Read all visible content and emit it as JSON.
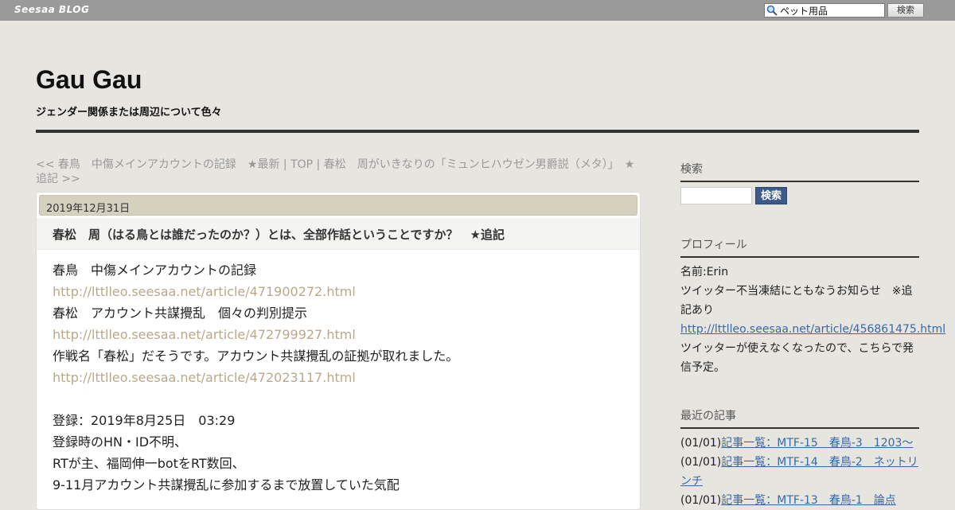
{
  "topbar": {
    "logo": "Seesaa BLOG",
    "search_value": "ペット用品",
    "search_button": "検索"
  },
  "header": {
    "title": "Gau Gau",
    "description": "ジェンダー関係または周辺について色々"
  },
  "article_nav": {
    "prev": "<< 春鳥　中傷メインアカウントの記録　★最新",
    "sep1": " | ",
    "top": "TOP",
    "sep2": " | ",
    "next": "春松　周がいきなりの「ミュンヒハウゼン男爵説（メタ）」　★追記 >>"
  },
  "entry": {
    "date": "2019年12月31日",
    "title": "春松　周（はる鳥とは誰だったのか？）とは、全部作話ということですか？　★追記",
    "lines": [
      {
        "text": "春鳥　中傷メインアカウントの記録",
        "link": false
      },
      {
        "text": "http://lttlleo.seesaa.net/article/471900272.html",
        "link": true
      },
      {
        "text": "春松　アカウント共謀攪乱　個々の判別提示",
        "link": false
      },
      {
        "text": "http://lttlleo.seesaa.net/article/472799927.html",
        "link": true
      },
      {
        "text": "作戦名「春松」だそうです。アカウント共謀攪乱の証拠が取れました。",
        "link": false
      },
      {
        "text": "http://lttlleo.seesaa.net/article/472023117.html",
        "link": true
      },
      {
        "text": "",
        "link": false
      },
      {
        "text": "登録：2019年8月25日　03:29",
        "link": false
      },
      {
        "text": "登録時のHN・ID不明、",
        "link": false
      },
      {
        "text": "RTが主、福岡伸一botをRT数回、",
        "link": false
      },
      {
        "text": "9-11月アカウント共謀攪乱に参加するまで放置していた気配",
        "link": false
      }
    ]
  },
  "sidebar": {
    "search": {
      "heading": "検索",
      "button": "検索"
    },
    "profile": {
      "heading": "プロフィール",
      "name": "名前:Erin",
      "notice": "ツイッター不当凍結にともなうお知らせ　※追記あり",
      "link": "http://lttlleo.seesaa.net/article/456861475.html",
      "note": "ツイッターが使えなくなったので、こちらで発信予定。"
    },
    "recent": {
      "heading": "最近の記事",
      "items": [
        {
          "date": "(01/01)",
          "title": "記事一覧：MTF-15　春鳥-3　1203～"
        },
        {
          "date": "(01/01)",
          "title": "記事一覧：MTF-14　春鳥-2　ネットリンチ"
        },
        {
          "date": "(01/01)",
          "title": "記事一覧：MTF-13　春鳥-1　論点"
        }
      ]
    }
  }
}
